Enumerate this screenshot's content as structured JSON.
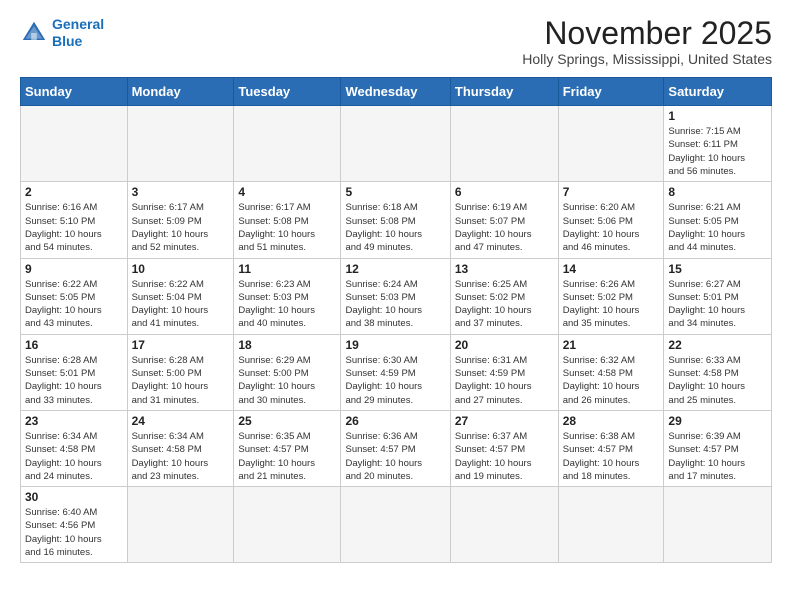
{
  "header": {
    "logo_line1": "General",
    "logo_line2": "Blue",
    "month_title": "November 2025",
    "location": "Holly Springs, Mississippi, United States"
  },
  "days_of_week": [
    "Sunday",
    "Monday",
    "Tuesday",
    "Wednesday",
    "Thursday",
    "Friday",
    "Saturday"
  ],
  "weeks": [
    [
      {
        "day": "",
        "info": ""
      },
      {
        "day": "",
        "info": ""
      },
      {
        "day": "",
        "info": ""
      },
      {
        "day": "",
        "info": ""
      },
      {
        "day": "",
        "info": ""
      },
      {
        "day": "",
        "info": ""
      },
      {
        "day": "1",
        "info": "Sunrise: 7:15 AM\nSunset: 6:11 PM\nDaylight: 10 hours\nand 56 minutes."
      }
    ],
    [
      {
        "day": "2",
        "info": "Sunrise: 6:16 AM\nSunset: 5:10 PM\nDaylight: 10 hours\nand 54 minutes."
      },
      {
        "day": "3",
        "info": "Sunrise: 6:17 AM\nSunset: 5:09 PM\nDaylight: 10 hours\nand 52 minutes."
      },
      {
        "day": "4",
        "info": "Sunrise: 6:17 AM\nSunset: 5:08 PM\nDaylight: 10 hours\nand 51 minutes."
      },
      {
        "day": "5",
        "info": "Sunrise: 6:18 AM\nSunset: 5:08 PM\nDaylight: 10 hours\nand 49 minutes."
      },
      {
        "day": "6",
        "info": "Sunrise: 6:19 AM\nSunset: 5:07 PM\nDaylight: 10 hours\nand 47 minutes."
      },
      {
        "day": "7",
        "info": "Sunrise: 6:20 AM\nSunset: 5:06 PM\nDaylight: 10 hours\nand 46 minutes."
      },
      {
        "day": "8",
        "info": "Sunrise: 6:21 AM\nSunset: 5:05 PM\nDaylight: 10 hours\nand 44 minutes."
      }
    ],
    [
      {
        "day": "9",
        "info": "Sunrise: 6:22 AM\nSunset: 5:05 PM\nDaylight: 10 hours\nand 43 minutes."
      },
      {
        "day": "10",
        "info": "Sunrise: 6:22 AM\nSunset: 5:04 PM\nDaylight: 10 hours\nand 41 minutes."
      },
      {
        "day": "11",
        "info": "Sunrise: 6:23 AM\nSunset: 5:03 PM\nDaylight: 10 hours\nand 40 minutes."
      },
      {
        "day": "12",
        "info": "Sunrise: 6:24 AM\nSunset: 5:03 PM\nDaylight: 10 hours\nand 38 minutes."
      },
      {
        "day": "13",
        "info": "Sunrise: 6:25 AM\nSunset: 5:02 PM\nDaylight: 10 hours\nand 37 minutes."
      },
      {
        "day": "14",
        "info": "Sunrise: 6:26 AM\nSunset: 5:02 PM\nDaylight: 10 hours\nand 35 minutes."
      },
      {
        "day": "15",
        "info": "Sunrise: 6:27 AM\nSunset: 5:01 PM\nDaylight: 10 hours\nand 34 minutes."
      }
    ],
    [
      {
        "day": "16",
        "info": "Sunrise: 6:28 AM\nSunset: 5:01 PM\nDaylight: 10 hours\nand 33 minutes."
      },
      {
        "day": "17",
        "info": "Sunrise: 6:28 AM\nSunset: 5:00 PM\nDaylight: 10 hours\nand 31 minutes."
      },
      {
        "day": "18",
        "info": "Sunrise: 6:29 AM\nSunset: 5:00 PM\nDaylight: 10 hours\nand 30 minutes."
      },
      {
        "day": "19",
        "info": "Sunrise: 6:30 AM\nSunset: 4:59 PM\nDaylight: 10 hours\nand 29 minutes."
      },
      {
        "day": "20",
        "info": "Sunrise: 6:31 AM\nSunset: 4:59 PM\nDaylight: 10 hours\nand 27 minutes."
      },
      {
        "day": "21",
        "info": "Sunrise: 6:32 AM\nSunset: 4:58 PM\nDaylight: 10 hours\nand 26 minutes."
      },
      {
        "day": "22",
        "info": "Sunrise: 6:33 AM\nSunset: 4:58 PM\nDaylight: 10 hours\nand 25 minutes."
      }
    ],
    [
      {
        "day": "23",
        "info": "Sunrise: 6:34 AM\nSunset: 4:58 PM\nDaylight: 10 hours\nand 24 minutes."
      },
      {
        "day": "24",
        "info": "Sunrise: 6:34 AM\nSunset: 4:58 PM\nDaylight: 10 hours\nand 23 minutes."
      },
      {
        "day": "25",
        "info": "Sunrise: 6:35 AM\nSunset: 4:57 PM\nDaylight: 10 hours\nand 21 minutes."
      },
      {
        "day": "26",
        "info": "Sunrise: 6:36 AM\nSunset: 4:57 PM\nDaylight: 10 hours\nand 20 minutes."
      },
      {
        "day": "27",
        "info": "Sunrise: 6:37 AM\nSunset: 4:57 PM\nDaylight: 10 hours\nand 19 minutes."
      },
      {
        "day": "28",
        "info": "Sunrise: 6:38 AM\nSunset: 4:57 PM\nDaylight: 10 hours\nand 18 minutes."
      },
      {
        "day": "29",
        "info": "Sunrise: 6:39 AM\nSunset: 4:57 PM\nDaylight: 10 hours\nand 17 minutes."
      }
    ],
    [
      {
        "day": "30",
        "info": "Sunrise: 6:40 AM\nSunset: 4:56 PM\nDaylight: 10 hours\nand 16 minutes."
      },
      {
        "day": "",
        "info": ""
      },
      {
        "day": "",
        "info": ""
      },
      {
        "day": "",
        "info": ""
      },
      {
        "day": "",
        "info": ""
      },
      {
        "day": "",
        "info": ""
      },
      {
        "day": "",
        "info": ""
      }
    ]
  ]
}
